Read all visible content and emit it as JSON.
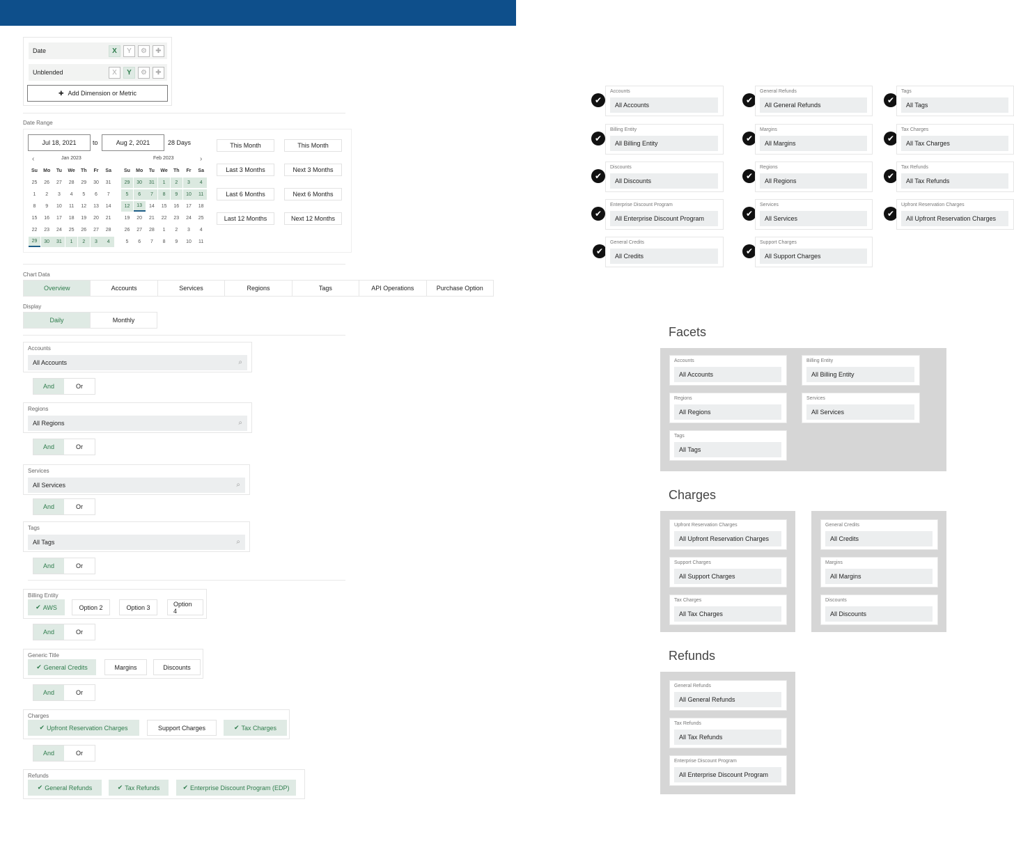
{
  "dimensions": [
    {
      "label": "Date",
      "x": "X",
      "y": "Y",
      "x_on": true,
      "y_on": false
    },
    {
      "label": "Unblended",
      "x": "X",
      "y": "Y",
      "x_on": false,
      "y_on": true
    }
  ],
  "add_dimension_label": "Add Dimension or Metric",
  "date_range": {
    "label": "Date Range",
    "start": "Jul 18, 2021",
    "to": "to",
    "end": "Aug 2, 2021",
    "days": "28 Days",
    "cal1": {
      "title": "Jan 2023",
      "weekdays": [
        "Su",
        "Mo",
        "Tu",
        "We",
        "Th",
        "Fr",
        "Sa"
      ],
      "weeks": [
        [
          "25",
          "26",
          "27",
          "28",
          "29",
          "30",
          "31"
        ],
        [
          "1",
          "2",
          "3",
          "4",
          "5",
          "6",
          "7"
        ],
        [
          "8",
          "9",
          "10",
          "11",
          "12",
          "13",
          "14"
        ],
        [
          "15",
          "16",
          "17",
          "18",
          "19",
          "20",
          "21"
        ],
        [
          "22",
          "23",
          "24",
          "25",
          "26",
          "27",
          "28"
        ],
        [
          "29",
          "30",
          "31",
          "1",
          "2",
          "3",
          "4"
        ]
      ]
    },
    "cal2": {
      "title": "Feb 2023",
      "weekdays": [
        "Su",
        "Mo",
        "Tu",
        "We",
        "Th",
        "Fr",
        "Sa"
      ],
      "weeks": [
        [
          "29",
          "30",
          "31",
          "1",
          "2",
          "3",
          "4"
        ],
        [
          "5",
          "6",
          "7",
          "8",
          "9",
          "10",
          "11"
        ],
        [
          "12",
          "13",
          "14",
          "15",
          "16",
          "17",
          "18"
        ],
        [
          "19",
          "20",
          "21",
          "22",
          "23",
          "24",
          "25"
        ],
        [
          "26",
          "27",
          "28",
          "1",
          "2",
          "3",
          "4"
        ],
        [
          "5",
          "6",
          "7",
          "8",
          "9",
          "10",
          "11"
        ]
      ]
    },
    "presets_left": [
      "This Month",
      "Last 3 Months",
      "Last 6 Months",
      "Last 12 Months"
    ],
    "presets_right": [
      "This Month",
      "Next 3 Months",
      "Next 6 Months",
      "Next 12 Months"
    ]
  },
  "chart_data_label": "Chart Data",
  "tabs": [
    "Overview",
    "Accounts",
    "Services",
    "Regions",
    "Tags",
    "API Operations",
    "Purchase Option"
  ],
  "display_label": "Display",
  "display_opts": [
    "Daily",
    "Monthly"
  ],
  "filters": [
    {
      "label": "Accounts",
      "value": "All Accounts"
    },
    {
      "label": "Regions",
      "value": "All Regions"
    },
    {
      "label": "Services",
      "value": "All Services"
    },
    {
      "label": "Tags",
      "value": "All Tags"
    }
  ],
  "andor": {
    "and": "And",
    "or": "Or"
  },
  "billing": {
    "label": "Billing Entity",
    "chips": [
      "AWS",
      "Option 2",
      "Option 3",
      "Option 4"
    ]
  },
  "generic": {
    "label": "Generic Title",
    "chips": [
      "General Credits",
      "Margins",
      "Discounts"
    ]
  },
  "charges": {
    "label": "Charges",
    "chips": [
      "Upfront Reservation Charges",
      "Support Charges",
      "Tax Charges"
    ]
  },
  "refunds": {
    "label": "Refunds",
    "chips": [
      "General Refunds",
      "Tax Refunds",
      "Enterprise Discount Program (EDP)"
    ]
  },
  "right_cards": [
    {
      "label": "Accounts",
      "value": "All Accounts"
    },
    {
      "label": "General Refunds",
      "value": "All General Refunds"
    },
    {
      "label": "Tags",
      "value": "All Tags"
    },
    {
      "label": "Billing Entity",
      "value": "All Billing Entity"
    },
    {
      "label": "Margins",
      "value": "All Margins"
    },
    {
      "label": "Tax Charges",
      "value": "All Tax Charges"
    },
    {
      "label": "Discounts",
      "value": "All Discounts"
    },
    {
      "label": "Regions",
      "value": "All Regions"
    },
    {
      "label": "Tax Refunds",
      "value": "All Tax Refunds"
    },
    {
      "label": "Enterprise Discount Program",
      "value": "All Enterprise Discount Program"
    },
    {
      "label": "Services",
      "value": "All Services"
    },
    {
      "label": "Upfront Reservation Charges",
      "value": "All Upfront Reservation Charges"
    },
    {
      "label": "General Credits",
      "value": "All Credits"
    },
    {
      "label": "Support Charges",
      "value": "All Support Charges"
    }
  ],
  "facets": {
    "title": "Facets",
    "cards": [
      {
        "label": "Accounts",
        "value": "All Accounts"
      },
      {
        "label": "Billing Entity",
        "value": "All Billing Entity"
      },
      {
        "label": "Regions",
        "value": "All Regions"
      },
      {
        "label": "Services",
        "value": "All Services"
      },
      {
        "label": "Tags",
        "value": "All Tags"
      }
    ]
  },
  "charges_section": {
    "title": "Charges",
    "left": [
      {
        "label": "Upfront Reservation Charges",
        "value": "All Upfront Reservation Charges"
      },
      {
        "label": "Support Charges",
        "value": "All Support Charges"
      },
      {
        "label": "Tax Charges",
        "value": "All Tax Charges"
      }
    ],
    "right": [
      {
        "label": "General Credits",
        "value": "All Credits"
      },
      {
        "label": "Margins",
        "value": "All Margins"
      },
      {
        "label": "Discounts",
        "value": "All Discounts"
      }
    ]
  },
  "refunds_section": {
    "title": "Refunds",
    "cards": [
      {
        "label": "General Refunds",
        "value": "All General Refunds"
      },
      {
        "label": "Tax Refunds",
        "value": "All Tax Refunds"
      },
      {
        "label": "Enterprise Discount Program",
        "value": "All Enterprise Discount Program"
      }
    ]
  }
}
